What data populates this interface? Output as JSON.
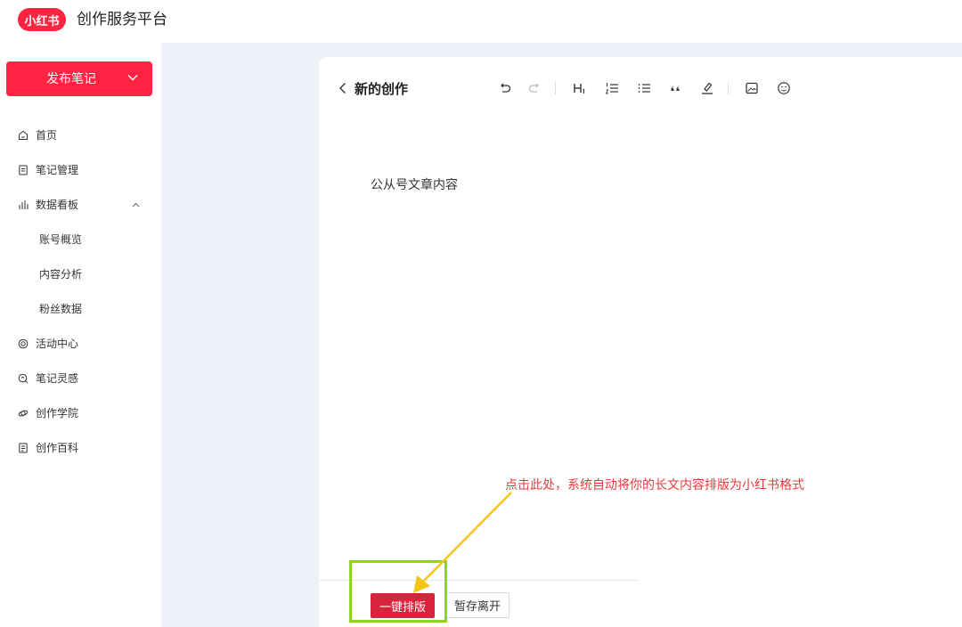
{
  "header": {
    "logo_text": "小红书",
    "title": "创作服务平台"
  },
  "sidebar": {
    "publish_button": {
      "label": "发布笔记",
      "icon": "chevron-down-icon"
    },
    "items": [
      {
        "label": "首页",
        "icon": "home-icon"
      },
      {
        "label": "笔记管理",
        "icon": "note-icon"
      },
      {
        "label": "数据看板",
        "icon": "bar-chart-icon",
        "expanded": true
      },
      {
        "label": "账号概览"
      },
      {
        "label": "内容分析"
      },
      {
        "label": "粉丝数据"
      },
      {
        "label": "活动中心",
        "icon": "activity-icon"
      },
      {
        "label": "笔记灵感",
        "icon": "inspiration-icon"
      },
      {
        "label": "创作学院",
        "icon": "academy-icon"
      },
      {
        "label": "创作百科",
        "icon": "encyclopedia-icon"
      }
    ]
  },
  "editor": {
    "back_title": "新的创作",
    "toolbar": [
      "undo-icon",
      "redo-icon",
      "heading-icon",
      "ordered-list-icon",
      "bullet-list-icon",
      "quote-icon",
      "highlight-icon",
      "image-icon",
      "emoji-icon"
    ],
    "content": "公从号文章内容",
    "format_button": "一键排版",
    "save_button": "暂存离开"
  },
  "annotation": {
    "text": "点击此处，系统自动将你的长文内容排版为小红书格式",
    "text_color": "#e63b3b",
    "box_color": "#8fd619",
    "arrow_color": "#f5c518"
  },
  "colors": {
    "brand": "#ff2442",
    "format_button": "#d8243a",
    "main_background": "#eef1f7"
  }
}
